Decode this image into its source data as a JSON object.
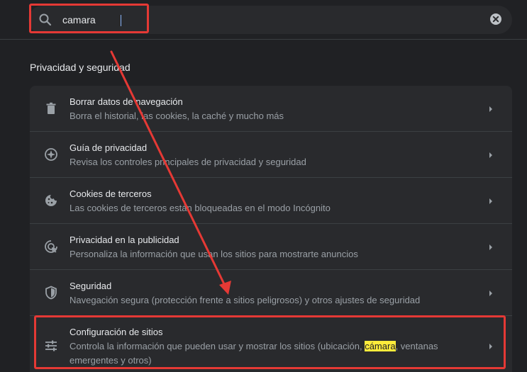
{
  "search": {
    "value": "camara",
    "icon": "search-icon",
    "clear_icon": "clear-icon"
  },
  "section": {
    "title": "Privacidad y seguridad"
  },
  "items": [
    {
      "title": "Borrar datos de navegación",
      "subtitle": "Borra el historial, las cookies, la caché y mucho más",
      "icon": "trash-icon"
    },
    {
      "title": "Guía de privacidad",
      "subtitle": "Revisa los controles principales de privacidad y seguridad",
      "icon": "compass-icon"
    },
    {
      "title": "Cookies de terceros",
      "subtitle": "Las cookies de terceros están bloqueadas en el modo Incógnito",
      "icon": "cookie-icon"
    },
    {
      "title": "Privacidad en la publicidad",
      "subtitle": "Personaliza la información que usan los sitios para mostrarte anuncios",
      "icon": "ad-privacy-icon"
    },
    {
      "title": "Seguridad",
      "subtitle": "Navegación segura (protección frente a sitios peligrosos) y otros ajustes de seguridad",
      "icon": "shield-icon"
    },
    {
      "title": "Configuración de sitios",
      "subtitle_before": "Controla la información que pueden usar y mostrar los sitios (ubicación, ",
      "subtitle_highlight": "cámara",
      "subtitle_after": ", ventanas",
      "subtitle_line2": "emergentes y otros)",
      "icon": "sliders-icon"
    }
  ],
  "colors": {
    "background": "#202124",
    "card": "#292a2d",
    "annotation": "#e53935",
    "highlight": "#ffeb3b"
  }
}
